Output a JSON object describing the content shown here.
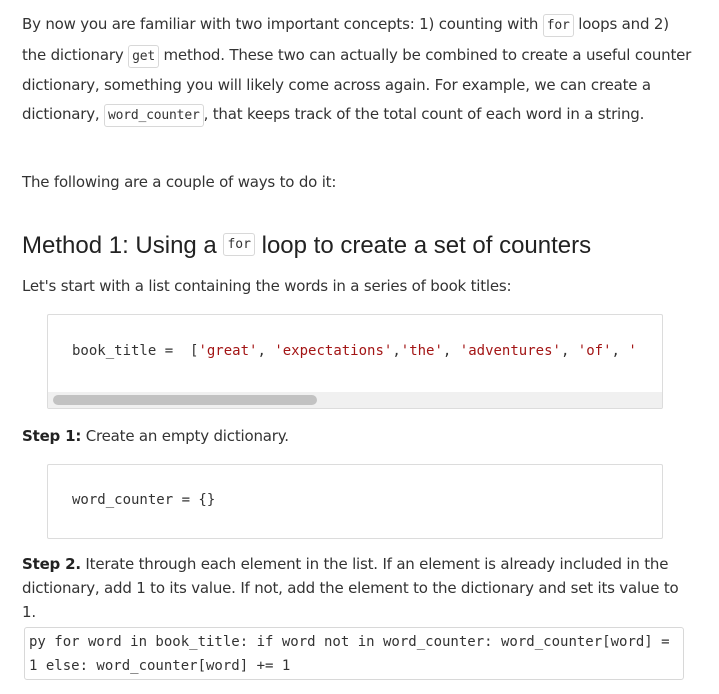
{
  "intro": {
    "p1_a": "By now you are familiar with two important concepts: 1) counting with ",
    "code_for": "for",
    "p1_b": " loops and 2) the dictionary ",
    "code_get": "get",
    "p1_c": " method. These two can actually be combined to create a useful counter dictionary, something you will likely come across again. For example, we can create a dictionary, ",
    "code_word_counter": "word_counter",
    "p1_d": ", that keeps track of the total count of each word in a string.",
    "p2": "The following are a couple of ways to do it:"
  },
  "method1": {
    "heading_a": "Method 1: Using a ",
    "heading_code": "for",
    "heading_b": " loop to create a set of counters",
    "lead": "Let's start with a list containing the words in a series of book titles:",
    "code1_var": "book_title = ",
    "code1_items": [
      "'great'",
      "'expectations'",
      "'the'",
      "'adventures'",
      "'of'",
      "'"
    ],
    "step1_label": "Step 1:",
    "step1_text": " Create an empty dictionary.",
    "code2": "word_counter = {}",
    "step2_label": "Step 2.",
    "step2_text": " Iterate through each element in the list. If an element is already included in the dictionary, add 1 to its value. If not, add the element to the dictionary and set its value to 1.",
    "code3": "py for word in book_title: if word not in word_counter: word_counter[word] = 1 else: word_counter[word] += 1"
  }
}
